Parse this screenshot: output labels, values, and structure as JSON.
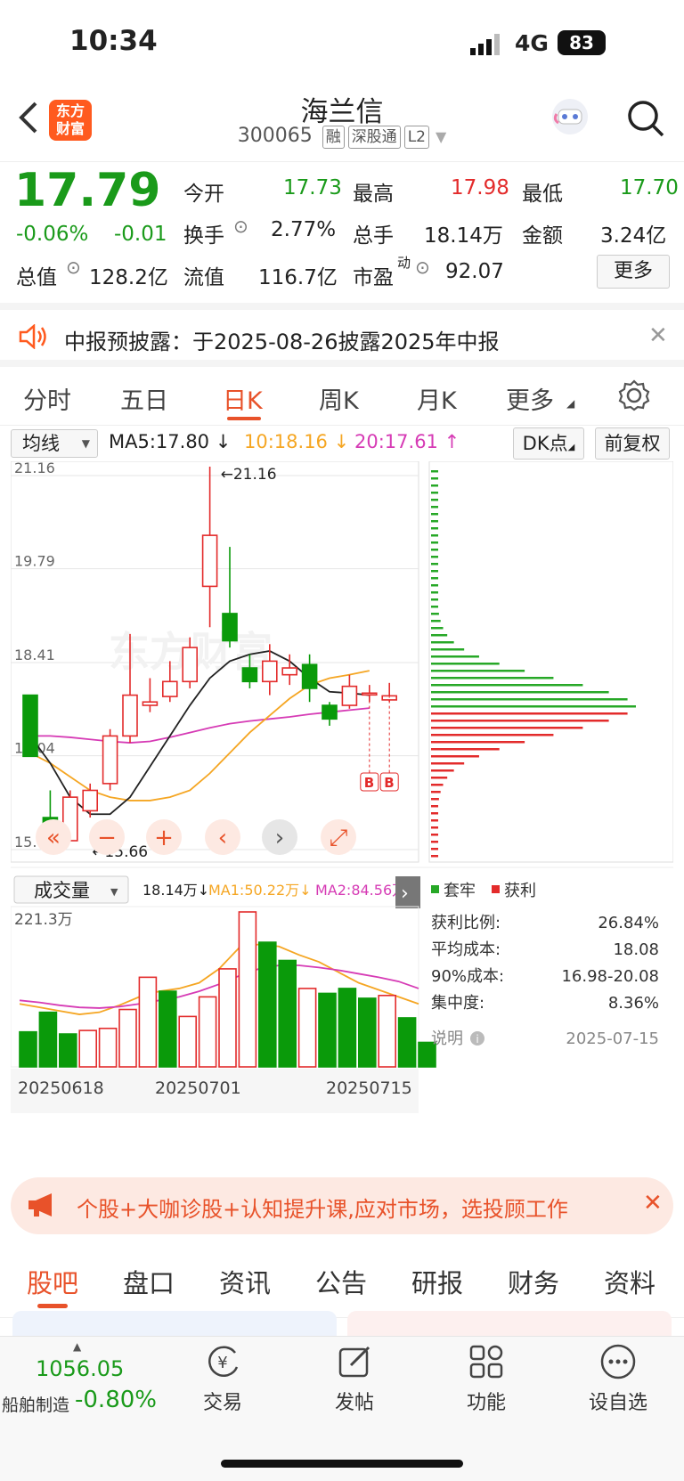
{
  "status": {
    "time": "10:34",
    "network": "4G",
    "battery": "83"
  },
  "header": {
    "back_icon": "chevron-left-icon",
    "logo_text": [
      "东方",
      "财富"
    ],
    "title": "海兰信",
    "code": "300065",
    "tags": [
      "融",
      "深股通",
      "L2"
    ]
  },
  "quote": {
    "price": "17.79",
    "change_pct": "-0.06%",
    "change": "-0.01",
    "open_label": "今开",
    "open": "17.73",
    "high_label": "最高",
    "high": "17.98",
    "low_label": "最低",
    "low": "17.70",
    "turnover_label": "换手",
    "turnover": "2.77%",
    "volume_label": "总手",
    "volume": "18.14万",
    "amount_label": "金额",
    "amount": "3.24亿",
    "mktcap_label": "总值",
    "mktcap": "128.2亿",
    "float_label": "流值",
    "float": "116.7亿",
    "pe_label": "市盈",
    "pe_sup": "动",
    "pe": "92.07",
    "more_label": "更多"
  },
  "notice": {
    "text": "中报预披露：于2025-08-26披露2025年中报"
  },
  "kline_tabs": [
    "分时",
    "五日",
    "日K",
    "周K",
    "月K",
    "更多"
  ],
  "kline_active": "日K",
  "ma_row": {
    "selector": "均线",
    "ma5": "MA5:17.80",
    "ma10": "10:18.16",
    "ma20": "20:17.61",
    "dk_label": "DK点",
    "fq_label": "前复权"
  },
  "colors": {
    "up": "#e32b2b",
    "down": "#0a9a0a",
    "ma5": "#222222",
    "ma10": "#f5a623",
    "ma20": "#d63bb5",
    "accent": "#ff5a1f"
  },
  "chart_data": [
    {
      "type": "candlestick",
      "y_ticks": [
        "21.16",
        "19.79",
        "18.41",
        "17.04",
        "15.66"
      ],
      "ylim": [
        15.66,
        21.16
      ],
      "max_label": "21.16",
      "min_label": "15.66",
      "candles": [
        {
          "o": 17.8,
          "c": 16.9,
          "h": 17.8,
          "l": 16.9
        },
        {
          "o": 16.0,
          "c": 15.9,
          "h": 16.4,
          "l": 15.8
        },
        {
          "o": 15.66,
          "c": 16.3,
          "h": 16.4,
          "l": 15.66
        },
        {
          "o": 16.1,
          "c": 16.4,
          "h": 16.5,
          "l": 16.0
        },
        {
          "o": 16.5,
          "c": 17.2,
          "h": 17.3,
          "l": 16.4
        },
        {
          "o": 17.2,
          "c": 17.8,
          "h": 18.7,
          "l": 17.1
        },
        {
          "o": 17.65,
          "c": 17.7,
          "h": 18.05,
          "l": 17.55
        },
        {
          "o": 17.78,
          "c": 18.0,
          "h": 18.3,
          "l": 17.7
        },
        {
          "o": 18.0,
          "c": 18.5,
          "h": 18.65,
          "l": 17.9
        },
        {
          "o": 19.4,
          "c": 20.15,
          "h": 21.16,
          "l": 18.8
        },
        {
          "o": 19.0,
          "c": 18.6,
          "h": 19.98,
          "l": 18.5
        },
        {
          "o": 18.2,
          "c": 18.0,
          "h": 18.4,
          "l": 17.9
        },
        {
          "o": 18.0,
          "c": 18.3,
          "h": 18.55,
          "l": 17.8
        },
        {
          "o": 18.1,
          "c": 18.2,
          "h": 18.4,
          "l": 17.95
        },
        {
          "o": 18.25,
          "c": 17.9,
          "h": 18.4,
          "l": 17.7
        },
        {
          "o": 17.65,
          "c": 17.45,
          "h": 17.7,
          "l": 17.35
        },
        {
          "o": 17.65,
          "c": 17.93,
          "h": 18.1,
          "l": 17.6
        },
        {
          "o": 17.81,
          "c": 17.83,
          "h": 17.95,
          "l": 17.7
        },
        {
          "o": 17.73,
          "c": 17.79,
          "h": 17.98,
          "l": 17.7
        }
      ],
      "ma5": [
        17.2,
        16.8,
        16.3,
        16.05,
        16.05,
        16.3,
        16.75,
        17.2,
        17.65,
        18.05,
        18.3,
        18.4,
        18.45,
        18.3,
        18.05,
        17.85,
        17.83,
        17.8
      ],
      "ma10": [
        16.95,
        16.8,
        16.6,
        16.4,
        16.3,
        16.25,
        16.25,
        16.3,
        16.4,
        16.65,
        16.95,
        17.25,
        17.5,
        17.75,
        17.95,
        18.05,
        18.1,
        18.16
      ],
      "ma20": [
        17.2,
        17.2,
        17.18,
        17.15,
        17.12,
        17.1,
        17.12,
        17.18,
        17.25,
        17.32,
        17.38,
        17.42,
        17.45,
        17.48,
        17.52,
        17.55,
        17.58,
        17.61
      ],
      "signals": [
        "B",
        "B"
      ]
    },
    {
      "type": "bar",
      "title": "成交量",
      "vol": "18.14万",
      "ma1": "MA1:50.22万",
      "ma2": "MA2:84.56万",
      "ymax_label": "221.3万",
      "values": [
        50,
        78,
        47,
        52,
        55,
        82,
        128,
        108,
        72,
        100,
        140,
        221.3,
        178,
        152,
        112,
        105,
        112,
        98,
        102,
        70,
        35
      ],
      "up": [
        false,
        false,
        false,
        true,
        true,
        true,
        true,
        false,
        true,
        true,
        true,
        true,
        false,
        false,
        true,
        false,
        false,
        false,
        true,
        false,
        false
      ],
      "ma1_line": [
        90,
        85,
        80,
        75,
        78,
        88,
        100,
        108,
        112,
        120,
        140,
        170,
        175,
        172,
        160,
        150,
        135,
        120,
        110,
        100,
        90
      ],
      "ma2_line": [
        95,
        92,
        88,
        85,
        84,
        86,
        90,
        95,
        100,
        108,
        118,
        130,
        140,
        145,
        145,
        142,
        138,
        133,
        128,
        122,
        112
      ],
      "x_labels": [
        "20250618",
        "20250701",
        "20250715"
      ]
    },
    {
      "type": "chips",
      "legend": [
        "套牢",
        "获利"
      ],
      "stats": [
        {
          "label": "获利比例:",
          "value": "26.84%"
        },
        {
          "label": "平均成本:",
          "value": "18.08"
        },
        {
          "label": "90%成本:",
          "value": "16.98-20.08"
        },
        {
          "label": "集中度:",
          "value": "8.36%"
        }
      ],
      "note_label": "说明",
      "date": "2025-07-15"
    }
  ],
  "promo": {
    "text": "个股+大咖诊股+认知提升课,应对市场，选投顾工作"
  },
  "bottom_tabs": [
    "股吧",
    "盘口",
    "资讯",
    "公告",
    "研报",
    "财务",
    "资料"
  ],
  "bottom_active": "股吧",
  "bottom_nav": {
    "index_value": "1056.05",
    "index_name": "船舶制造",
    "index_change": "-0.80%",
    "items": [
      "交易",
      "发帖",
      "功能",
      "设自选"
    ]
  }
}
